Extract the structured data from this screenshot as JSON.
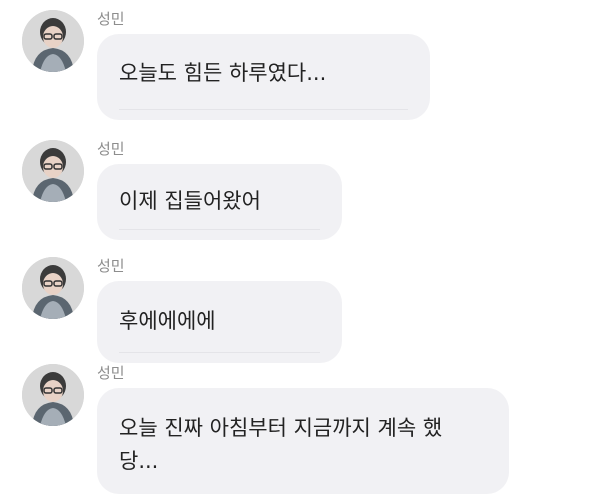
{
  "messages": [
    {
      "sender": "성민",
      "text": "오늘도 힘든 하루였다...",
      "avatar_icon": "profile-photo-icon"
    },
    {
      "sender": "성민",
      "text": "이제 집들어왔어",
      "avatar_icon": "profile-photo-icon"
    },
    {
      "sender": "성민",
      "text": "후에에에에",
      "avatar_icon": "profile-photo-icon"
    },
    {
      "sender": "성민",
      "text_line1": "오늘 진짜 아침부터 지금까지 계속 했",
      "text_line2": "당...",
      "avatar_icon": "profile-photo-icon"
    }
  ],
  "colors": {
    "bubble_bg": "#f1f1f4",
    "sender_text": "#8d8d8d",
    "message_text": "#222222"
  }
}
